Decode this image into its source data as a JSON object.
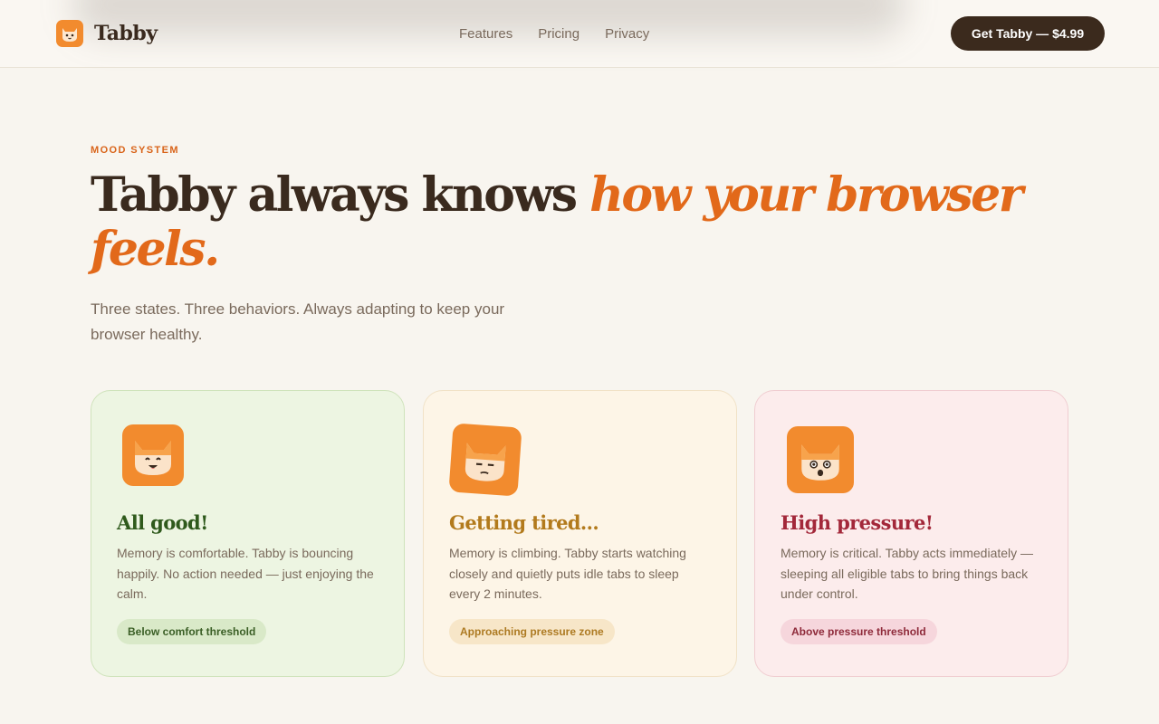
{
  "header": {
    "brand_name": "Tabby",
    "logo_icon": "cat-logo-icon",
    "nav": [
      {
        "label": "Features"
      },
      {
        "label": "Pricing"
      },
      {
        "label": "Privacy"
      }
    ],
    "cta_label": "Get Tabby — $4.99"
  },
  "hero": {
    "eyebrow": "MOOD SYSTEM",
    "headline_plain": "Tabby always knows ",
    "headline_accent": "how your browser feels.",
    "subhead": "Three states. Three behaviors. Always adapting to keep your browser healthy."
  },
  "cards": [
    {
      "icon": "happy-cat-icon",
      "title": "All good!",
      "text": "Memory is comfortable. Tabby is bouncing happily. No action needed — just enjoying the calm.",
      "badge": "Below comfort threshold"
    },
    {
      "icon": "tired-cat-icon",
      "title": "Getting tired...",
      "text": "Memory is climbing. Tabby starts watching closely and quietly puts idle tabs to sleep every 2 minutes.",
      "badge": "Approaching pressure zone"
    },
    {
      "icon": "shocked-cat-icon",
      "title": "High pressure!",
      "text": "Memory is critical. Tabby acts immediately — sleeping all eligible tabs to bring things back under control.",
      "badge": "Above pressure threshold"
    }
  ],
  "colors": {
    "accent": "#e2691a",
    "dark": "#3b2a1d",
    "background": "#f8f5ef",
    "good": "#2f5a1c",
    "tired": "#b27a1c",
    "high": "#a3283a"
  }
}
